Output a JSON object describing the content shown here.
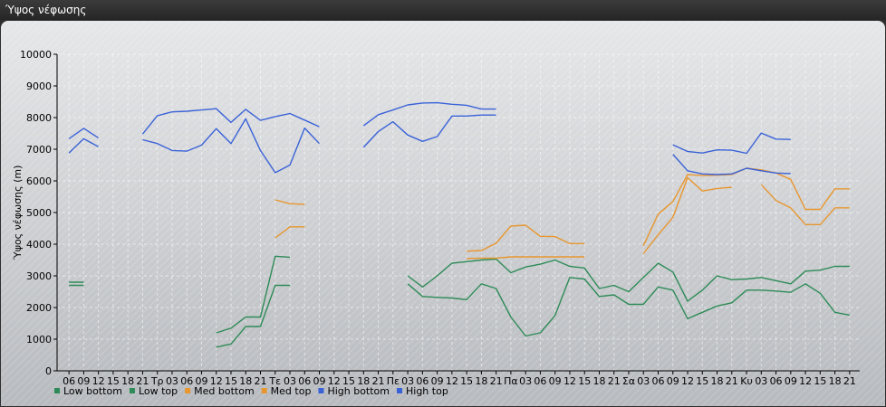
{
  "window": {
    "title": "Ύψος νέφωσης"
  },
  "chart_data": {
    "type": "line",
    "ylabel": "Ύψος νέφωσης (m)",
    "ylim": [
      0,
      10000
    ],
    "yticks": [
      0,
      1000,
      2000,
      3000,
      4000,
      5000,
      6000,
      7000,
      8000,
      9000,
      10000
    ],
    "grid": true,
    "legend_position": "bottom-left",
    "categories": [
      "06",
      "09",
      "12",
      "15",
      "18",
      "21",
      "Τρ",
      "03",
      "06",
      "09",
      "12",
      "15",
      "18",
      "21",
      "Τε",
      "03",
      "06",
      "09",
      "12",
      "15",
      "18",
      "21",
      "Πε",
      "03",
      "06",
      "09",
      "12",
      "15",
      "18",
      "21",
      "Πα",
      "03",
      "06",
      "09",
      "12",
      "15",
      "18",
      "21",
      "Σα",
      "03",
      "06",
      "09",
      "12",
      "15",
      "18",
      "21",
      "Κυ",
      "03",
      "06",
      "09",
      "12",
      "15",
      "18",
      "21"
    ],
    "series": [
      {
        "name": "Low bottom",
        "color": "#2e8b57",
        "values": [
          2700,
          2700,
          null,
          null,
          null,
          null,
          null,
          null,
          null,
          null,
          750,
          850,
          1400,
          1400,
          2700,
          2700,
          null,
          null,
          null,
          null,
          null,
          null,
          null,
          2750,
          2350,
          2320,
          2300,
          2250,
          2750,
          2600,
          1700,
          1100,
          1200,
          1750,
          2950,
          2900,
          2350,
          2400,
          2100,
          2100,
          2650,
          2550,
          1650,
          1850,
          2050,
          2150,
          2550,
          2550,
          2520,
          2480,
          2750,
          2450,
          1850,
          1760
        ]
      },
      {
        "name": "Low top",
        "color": "#2e8b57",
        "values": [
          2800,
          2800,
          null,
          null,
          null,
          null,
          null,
          null,
          null,
          null,
          1200,
          1350,
          1700,
          1700,
          3620,
          3590,
          null,
          null,
          null,
          null,
          null,
          null,
          null,
          3000,
          2650,
          3000,
          3400,
          3450,
          3500,
          3530,
          3100,
          3280,
          3370,
          3500,
          3300,
          3250,
          2600,
          2700,
          2500,
          2950,
          3400,
          3120,
          2200,
          2550,
          3000,
          2880,
          2900,
          2950,
          2850,
          2750,
          3150,
          3180,
          3300,
          3300
        ]
      },
      {
        "name": "Med bottom",
        "color": "#e8962e",
        "values": [
          null,
          null,
          null,
          null,
          null,
          null,
          null,
          null,
          null,
          null,
          null,
          null,
          null,
          null,
          4200,
          4550,
          4550,
          null,
          null,
          null,
          null,
          null,
          null,
          null,
          null,
          null,
          null,
          3780,
          3800,
          4030,
          4570,
          4600,
          4250,
          4240,
          4020,
          4020,
          null,
          null,
          null,
          3700,
          4300,
          4850,
          6100,
          5680,
          5760,
          5800,
          null,
          5880,
          5380,
          5150,
          4620,
          4620,
          5150,
          5150
        ]
      },
      {
        "name": "Med top",
        "color": "#e8962e",
        "values": [
          null,
          null,
          null,
          null,
          null,
          null,
          null,
          null,
          null,
          null,
          null,
          null,
          null,
          null,
          5400,
          5280,
          5260,
          null,
          null,
          null,
          null,
          null,
          null,
          null,
          null,
          null,
          null,
          3550,
          3560,
          3560,
          3600,
          3600,
          3600,
          3600,
          3600,
          3600,
          null,
          null,
          null,
          3950,
          4950,
          5350,
          6200,
          6170,
          6180,
          6200,
          6400,
          6350,
          6250,
          6050,
          5100,
          5100,
          5750,
          5750
        ]
      },
      {
        "name": "High bottom",
        "color": "#3a62d8",
        "values": [
          6880,
          7330,
          7080,
          null,
          null,
          7300,
          7180,
          6960,
          6940,
          7130,
          7650,
          7180,
          7960,
          6960,
          6260,
          6500,
          7670,
          7180,
          null,
          null,
          7060,
          7560,
          7870,
          7450,
          7250,
          7400,
          8050,
          8050,
          8080,
          8080,
          null,
          null,
          null,
          null,
          null,
          null,
          null,
          null,
          null,
          null,
          null,
          6840,
          6320,
          6220,
          6200,
          6220,
          6400,
          6320,
          6250,
          6230,
          null,
          null,
          null,
          null
        ]
      },
      {
        "name": "High top",
        "color": "#3a62d8",
        "values": [
          7330,
          7660,
          7360,
          null,
          null,
          7480,
          8060,
          8180,
          8200,
          8240,
          8280,
          7850,
          8260,
          7910,
          8030,
          8130,
          7920,
          7710,
          null,
          null,
          7740,
          8090,
          8240,
          8400,
          8460,
          8470,
          8420,
          8390,
          8270,
          8270,
          null,
          null,
          null,
          null,
          null,
          null,
          null,
          null,
          null,
          null,
          null,
          7140,
          6930,
          6880,
          6980,
          6970,
          6870,
          7510,
          7320,
          7310,
          null,
          null,
          null,
          null
        ]
      }
    ]
  }
}
